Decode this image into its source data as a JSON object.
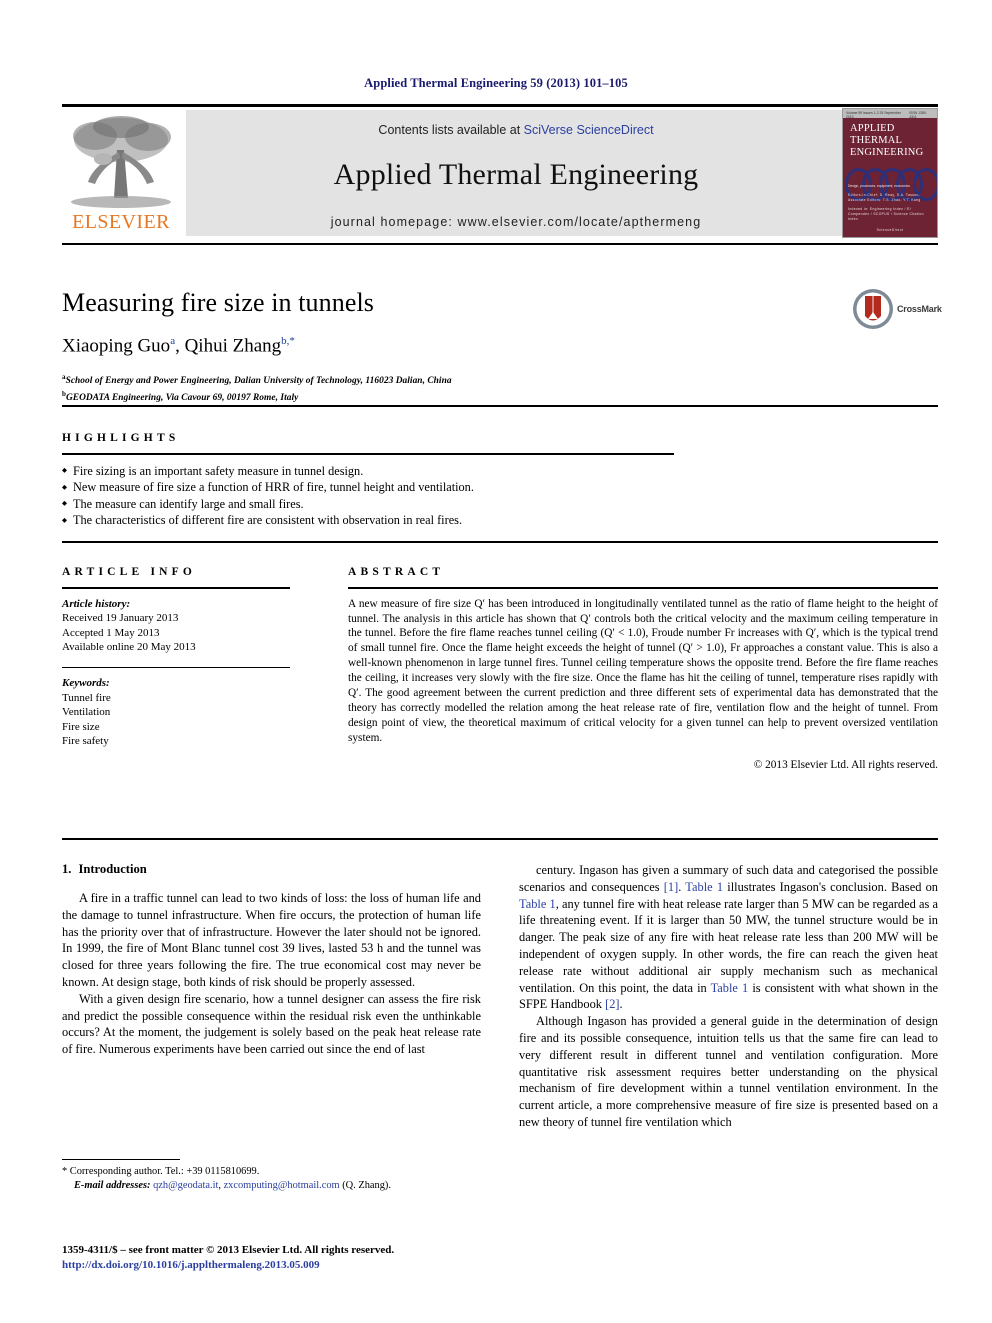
{
  "running_head": "Applied Thermal Engineering 59 (2013) 101–105",
  "banner": {
    "publisher_logo_label": "ELSEVIER",
    "contents_prefix": "Contents lists available at ",
    "contents_link": "SciVerse ScienceDirect",
    "journal_title": "Applied Thermal Engineering",
    "homepage": "journal homepage: www.elsevier.com/locate/apthermeng",
    "cover": {
      "title_line1": "APPLIED",
      "title_line2": "THERMAL",
      "title_line3": "ENGINEERING",
      "top_left": "Volume 59  Issues 1-2  25 September 2013",
      "top_right": "ISSN 1359-4311",
      "foot_line1": "Design, processes, equipment, economics",
      "foot_line2": "Editors-in-Chief: D. Reay, S.A. Tassou, Associate Editors: T.S. Zhao, Y.T. Kang",
      "foot_line3": "Indexed in: Engineering Index / Ei Compendex / SCOPUS / Science Citation Index",
      "foot_line4": "ScienceDirect"
    }
  },
  "article": {
    "title": "Measuring fire size in tunnels",
    "authors": [
      {
        "name": "Xiaoping Guo",
        "marks": "a"
      },
      {
        "name": "Qihui Zhang",
        "marks": "b,*"
      }
    ],
    "authors_joined": "Xiaoping Guo",
    "affiliations": [
      {
        "mark": "a",
        "text": "School of Energy and Power Engineering, Dalian University of Technology, 116023 Dalian, China"
      },
      {
        "mark": "b",
        "text": "GEODATA Engineering, Via Cavour 69, 00197 Rome, Italy"
      }
    ],
    "crossmark_label": "CrossMark"
  },
  "highlights": {
    "label": "HIGHLIGHTS",
    "items": [
      "Fire sizing is an important safety measure in tunnel design.",
      "New measure of fire size a function of HRR of fire, tunnel height and ventilation.",
      "The measure can identify large and small fires.",
      "The characteristics of different fire are consistent with observation in real fires."
    ]
  },
  "article_info": {
    "label": "ARTICLE INFO",
    "history_lead": "Article history:",
    "history": [
      "Received 19 January 2013",
      "Accepted 1 May 2013",
      "Available online 20 May 2013"
    ],
    "keywords_lead": "Keywords:",
    "keywords": [
      "Tunnel fire",
      "Ventilation",
      "Fire size",
      "Fire safety"
    ]
  },
  "abstract": {
    "label": "ABSTRACT",
    "text": "A new measure of fire size Q′ has been introduced in longitudinally ventilated tunnel as the ratio of flame height to the height of tunnel. The analysis in this article has shown that Q′ controls both the critical velocity and the maximum ceiling temperature in the tunnel. Before the fire flame reaches tunnel ceiling (Q′ < 1.0), Froude number Fr increases with Q′, which is the typical trend of small tunnel fire. Once the flame height exceeds the height of tunnel (Q′ > 1.0), Fr approaches a constant value. This is also a well-known phenomenon in large tunnel fires. Tunnel ceiling temperature shows the opposite trend. Before the fire flame reaches the ceiling, it increases very slowly with the fire size. Once the flame has hit the ceiling of tunnel, temperature rises rapidly with Q′. The good agreement between the current prediction and three different sets of experimental data has demonstrated that the theory has correctly modelled the relation among the heat release rate of fire, ventilation flow and the height of tunnel. From design point of view, the theoretical maximum of critical velocity for a given tunnel can help to prevent oversized ventilation system.",
    "copyright": "© 2013 Elsevier Ltd. All rights reserved."
  },
  "body": {
    "section_number": "1.",
    "section_title": "Introduction",
    "left_paragraphs": [
      "A fire in a traffic tunnel can lead to two kinds of loss: the loss of human life and the damage to tunnel infrastructure. When fire occurs, the protection of human life has the priority over that of infrastructure. However the later should not be ignored. In 1999, the fire of Mont Blanc tunnel cost 39 lives, lasted 53 h and the tunnel was closed for three years following the fire. The true economical cost may never be known. At design stage, both kinds of risk should be properly assessed.",
      "With a given design fire scenario, how a tunnel designer can assess the fire risk and predict the possible consequence within the residual risk even the unthinkable occurs? At the moment, the judgement is solely based on the peak heat release rate of fire. Numerous experiments have been carried out since the end of last"
    ],
    "right_paragraph_1_parts": [
      {
        "t": "century. Ingason has given a summary of such data and categorised the possible scenarios and consequences ",
        "link": false
      },
      {
        "t": "[1]",
        "link": true
      },
      {
        "t": ". ",
        "link": false
      },
      {
        "t": "Table 1",
        "link": true
      },
      {
        "t": " illustrates Ingason's conclusion. Based on ",
        "link": false
      },
      {
        "t": "Table 1",
        "link": true
      },
      {
        "t": ", any tunnel fire with heat release rate larger than 5 MW can be regarded as a life threatening event. If it is larger than 50 MW, the tunnel structure would be in danger. The peak size of any fire with heat release rate less than 200 MW will be independent of oxygen supply. In other words, the fire can reach the given heat release rate without additional air supply mechanism such as mechanical ventilation. On this point, the data in ",
        "link": false
      },
      {
        "t": "Table 1",
        "link": true
      },
      {
        "t": " is consistent with what shown in the SFPE Handbook ",
        "link": false
      },
      {
        "t": "[2]",
        "link": true
      },
      {
        "t": ".",
        "link": false
      }
    ],
    "right_paragraph_2": "Although Ingason has provided a general guide in the determination of design fire and its possible consequence, intuition tells us that the same fire can lead to very different result in different tunnel and ventilation configuration. More quantitative risk assessment requires better understanding on the physical mechanism of fire development within a tunnel ventilation environment. In the current article, a more comprehensive measure of fire size is presented based on a new theory of tunnel fire ventilation which"
  },
  "footnote": {
    "corresponding": "* Corresponding author. Tel.: +39 0115810699.",
    "email_lead": "E-mail addresses:",
    "email1": "qzh@geodata.it",
    "email_sep": ", ",
    "email2": "zxcomputing@hotmail.com",
    "email_suffix": " (Q. Zhang)."
  },
  "colophon": {
    "line1": "1359-4311/$ – see front matter © 2013 Elsevier Ltd. All rights reserved.",
    "doi": "http://dx.doi.org/10.1016/j.applthermaleng.2013.05.009"
  },
  "colors": {
    "link": "#2b3fa0",
    "running_head": "#1a1a6e",
    "elsevier_orange": "#E87722",
    "banner_bg": "#e3e3e3",
    "cover_bg": "#6e2335",
    "crossmark_red": "#b32a1e"
  }
}
